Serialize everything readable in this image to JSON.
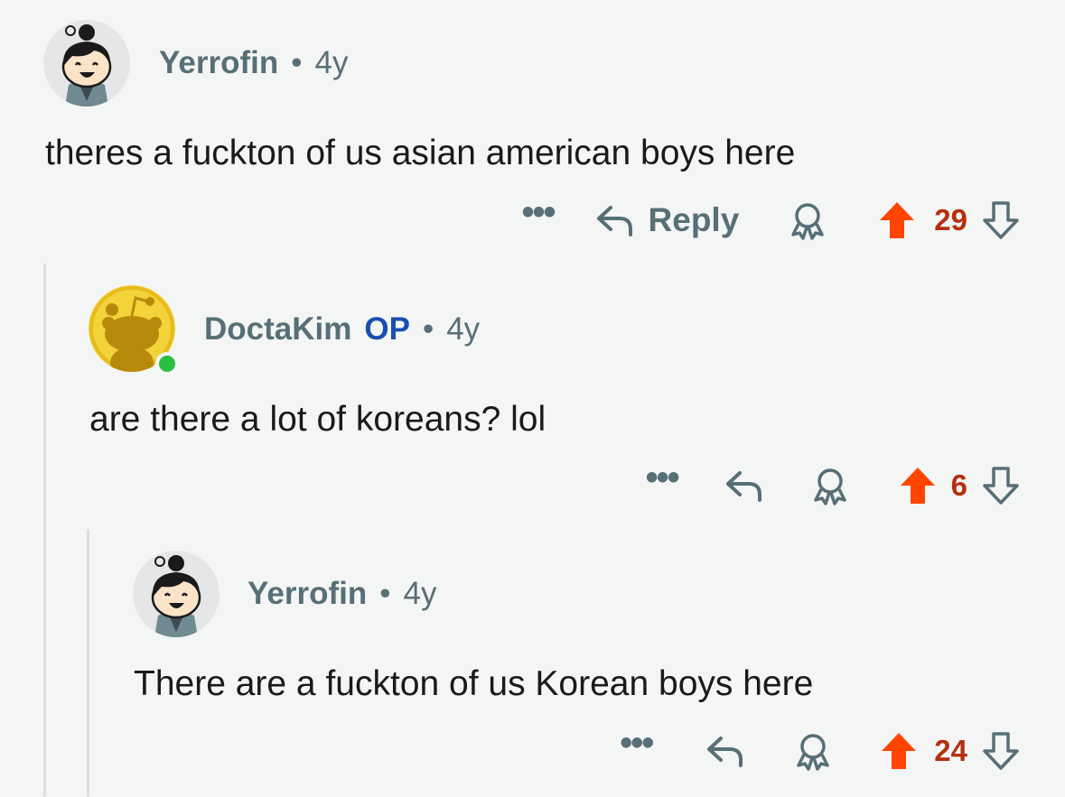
{
  "comments": [
    {
      "username": "Yerrofin",
      "op_badge": "",
      "separator": "•",
      "age": "4y",
      "text": "theres a fuckton of us asian american boys here",
      "more_label": "•••",
      "reply_label": "Reply",
      "score": "29",
      "avatar_icon": "snoo-avatar-bun-hair",
      "online": false
    },
    {
      "username": "DoctaKim",
      "op_badge": "OP",
      "separator": "•",
      "age": "4y",
      "text": "are there a lot of koreans? lol",
      "more_label": "•••",
      "reply_label": "",
      "score": "6",
      "avatar_icon": "snoo-default-avatar",
      "online": true
    },
    {
      "username": "Yerrofin",
      "op_badge": "",
      "separator": "•",
      "age": "4y",
      "text": "There are a fuckton of us Korean boys here",
      "more_label": "•••",
      "reply_label": "",
      "score": "24",
      "avatar_icon": "snoo-avatar-bun-hair",
      "online": false
    }
  ],
  "colors": {
    "upvote_active": "#ff4500",
    "score": "#b3300f",
    "op": "#1a4fb0",
    "meta": "#576f76",
    "online": "#2bbf3f"
  }
}
